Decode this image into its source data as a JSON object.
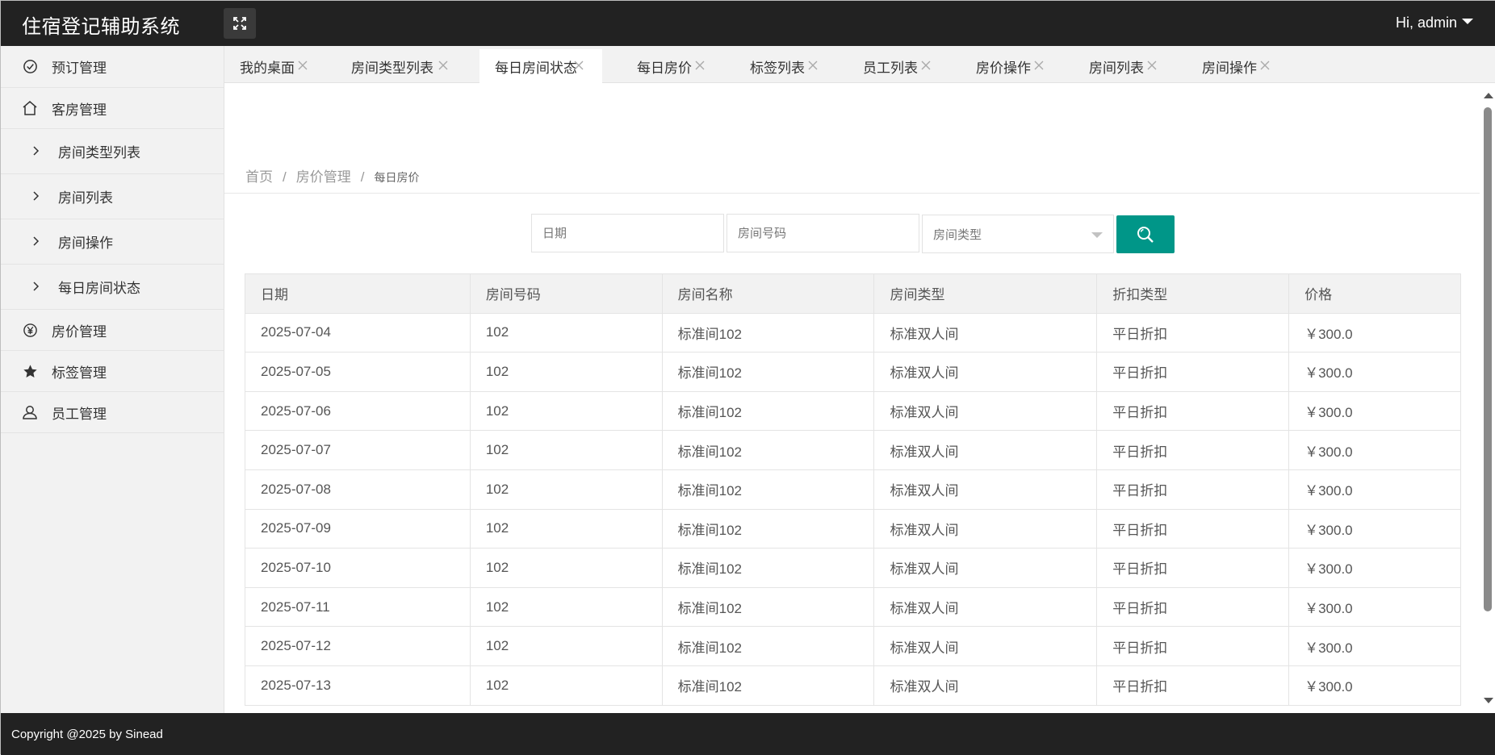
{
  "header": {
    "app_title": "住宿登记辅助系统",
    "user_label": "Hi, admin"
  },
  "sidebar": {
    "items": [
      {
        "label": "预订管理",
        "icon": "check-circle-icon"
      },
      {
        "label": "客房管理",
        "icon": "home-icon"
      },
      {
        "label": "房价管理",
        "icon": "yen-circle-icon"
      },
      {
        "label": "标签管理",
        "icon": "star-icon"
      },
      {
        "label": "员工管理",
        "icon": "user-icon"
      }
    ],
    "sub_items": [
      {
        "label": "房间类型列表"
      },
      {
        "label": "房间列表"
      },
      {
        "label": "房间操作"
      },
      {
        "label": "每日房间状态"
      }
    ]
  },
  "tabs": [
    {
      "label": "我的桌面",
      "active": false
    },
    {
      "label": "房间类型列表",
      "active": false
    },
    {
      "label": "每日房间状态",
      "active": true
    },
    {
      "label": "每日房价",
      "active": false
    },
    {
      "label": "标签列表",
      "active": false
    },
    {
      "label": "员工列表",
      "active": false
    },
    {
      "label": "房价操作",
      "active": false
    },
    {
      "label": "房间列表",
      "active": false
    },
    {
      "label": "房间操作",
      "active": false
    }
  ],
  "breadcrumb": {
    "home": "首页",
    "section": "房价管理",
    "current": "每日房价",
    "separator": "/"
  },
  "search": {
    "date_placeholder": "日期",
    "room_no_placeholder": "房间号码",
    "room_type_placeholder": "房间类型"
  },
  "table": {
    "headers": [
      "日期",
      "房间号码",
      "房间名称",
      "房间类型",
      "折扣类型",
      "价格"
    ],
    "rows": [
      [
        "2025-07-04",
        "102",
        "标准间102",
        "标准双人间",
        "平日折扣",
        "￥300.0"
      ],
      [
        "2025-07-05",
        "102",
        "标准间102",
        "标准双人间",
        "平日折扣",
        "￥300.0"
      ],
      [
        "2025-07-06",
        "102",
        "标准间102",
        "标准双人间",
        "平日折扣",
        "￥300.0"
      ],
      [
        "2025-07-07",
        "102",
        "标准间102",
        "标准双人间",
        "平日折扣",
        "￥300.0"
      ],
      [
        "2025-07-08",
        "102",
        "标准间102",
        "标准双人间",
        "平日折扣",
        "￥300.0"
      ],
      [
        "2025-07-09",
        "102",
        "标准间102",
        "标准双人间",
        "平日折扣",
        "￥300.0"
      ],
      [
        "2025-07-10",
        "102",
        "标准间102",
        "标准双人间",
        "平日折扣",
        "￥300.0"
      ],
      [
        "2025-07-11",
        "102",
        "标准间102",
        "标准双人间",
        "平日折扣",
        "￥300.0"
      ],
      [
        "2025-07-12",
        "102",
        "标准间102",
        "标准双人间",
        "平日折扣",
        "￥300.0"
      ],
      [
        "2025-07-13",
        "102",
        "标准间102",
        "标准双人间",
        "平日折扣",
        "￥300.0"
      ]
    ]
  },
  "footer": {
    "copyright": "Copyright @2025 by Sinead"
  },
  "colors": {
    "header_bg": "#222222",
    "accent": "#009688",
    "sidebar_bg": "#f2f2f2"
  }
}
